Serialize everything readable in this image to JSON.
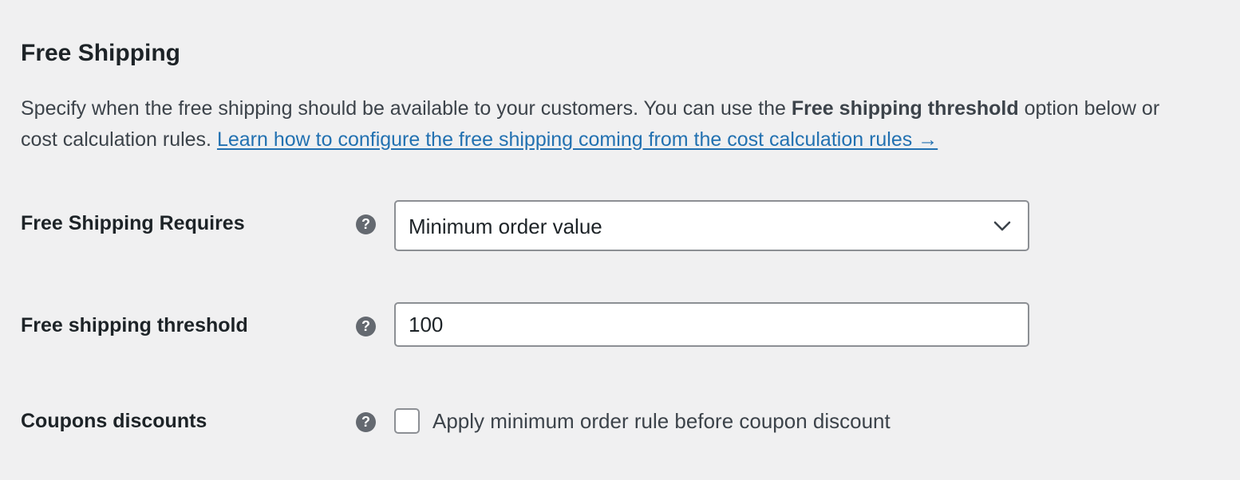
{
  "section": {
    "title": "Free Shipping",
    "description_part1": "Specify when the free shipping should be available to your customers. You can use the ",
    "description_bold": "Free shipping threshold",
    "description_part2": " option below or",
    "description_part3": "cost calculation rules. ",
    "link_text": "Learn how to configure the free shipping coming from the cost calculation rules →"
  },
  "fields": {
    "requires": {
      "label": "Free Shipping Requires",
      "help_icon": "question-circle-icon",
      "help_glyph": "?",
      "value": "Minimum order value",
      "chevron_icon": "chevron-down-icon"
    },
    "threshold": {
      "label": "Free shipping threshold",
      "help_icon": "question-circle-icon",
      "help_glyph": "?",
      "value": "100"
    },
    "coupons": {
      "label": "Coupons discounts",
      "help_icon": "question-circle-icon",
      "help_glyph": "?",
      "checked": false,
      "checkbox_label": "Apply minimum order rule before coupon discount"
    }
  },
  "colors": {
    "background": "#f0f0f1",
    "text": "#1d2327",
    "link": "#2271b1",
    "border": "#8c8f94",
    "help_icon": "#646970"
  }
}
